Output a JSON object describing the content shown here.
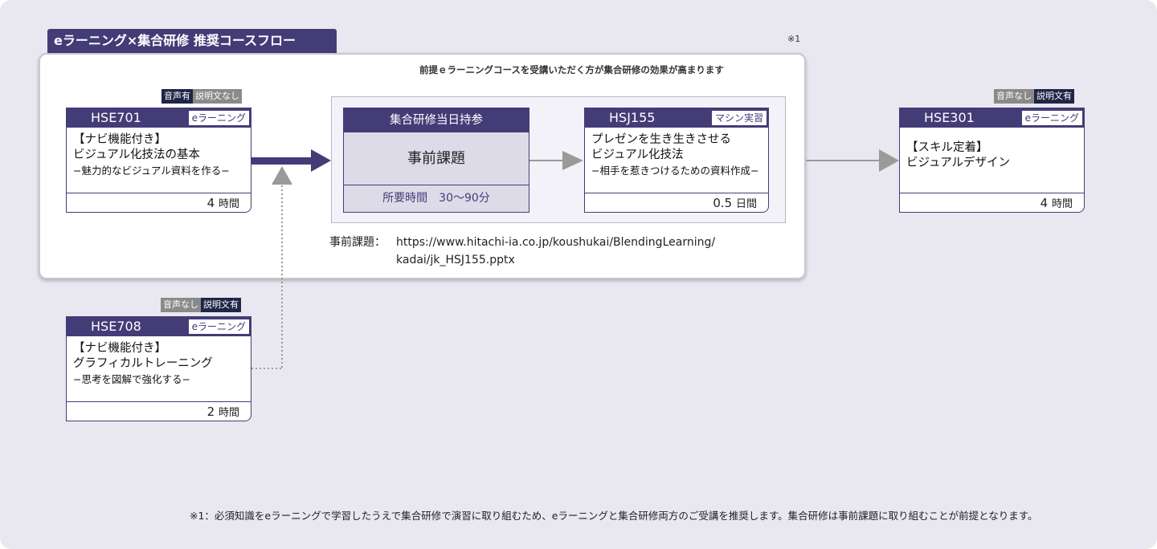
{
  "title": "eラーニング×集合研修 推奨コースフロー",
  "note_ref": "※1",
  "premise": "前提ｅラーニングコースを受講いただく方が集合研修の効果が高まります",
  "courses": {
    "hse701": {
      "tag_left": "音声有",
      "tag_right": "説明文なし",
      "code": "HSE701",
      "type": "eラーニング",
      "line1": "【ナビ機能付き】",
      "line2": "ビジュアル化技法の基本",
      "line3": "−魅力的なビジュアル資料を作る−",
      "duration_num": "4",
      "duration_unit": "時間"
    },
    "hse708": {
      "tag_left": "音声なし",
      "tag_right": "説明文有",
      "code": "HSE708",
      "type": "eラーニング",
      "line1": "【ナビ機能付き】",
      "line2": "グラフィカルトレーニング",
      "line3": "−思考を図解で強化する−",
      "duration_num": "2",
      "duration_unit": "時間"
    },
    "hsj155": {
      "code": "HSJ155",
      "type": "マシン実習",
      "line1": "プレゼンを生き生きさせる",
      "line2": "ビジュアル化技法",
      "line3": "−相手を惹きつけるための資料作成−",
      "duration_num": "0.5",
      "duration_unit": "日間"
    },
    "hse301": {
      "tag_left": "音声なし",
      "tag_right": "説明文有",
      "code": "HSE301",
      "type": "eラーニング",
      "line1": "【スキル定着】",
      "line2": "ビジュアルデザイン",
      "duration_num": "4",
      "duration_unit": "時間"
    }
  },
  "task": {
    "header": "集合研修当日持参",
    "title": "事前課題",
    "time": "所要時間　30〜90分"
  },
  "pre_task": {
    "label": "事前課題：",
    "url_line1": "https://www.hitachi-ia.co.jp/koushukai/BlendingLearning/",
    "url_line2": "kadai/jk_HSJ155.pptx"
  },
  "footnote": "※1：必須知識をeラーニングで学習したうえで集合研修で演習に取り組むため、eラーニングと集合研修両方のご受講を推奨します。集合研修は事前課題に取り組むことが前提となります。",
  "colors": {
    "accent": "#443c77",
    "tag_dark": "#1f2547",
    "tag_gray": "#8a8a8a",
    "arrow_gray": "#9a9a9a",
    "background": "#e9e8f0"
  }
}
